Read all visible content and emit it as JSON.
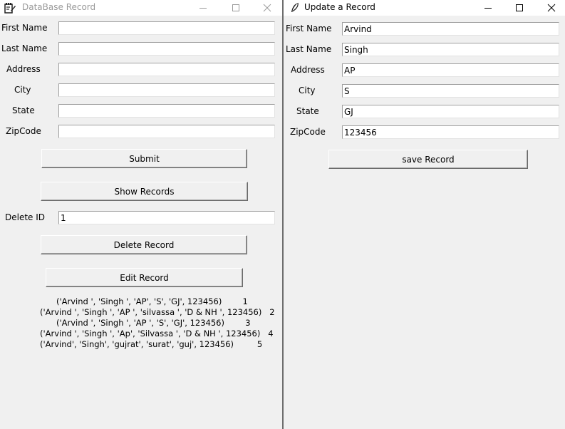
{
  "left_window": {
    "title": "DataBase Record",
    "labels": {
      "first_name": "First Name",
      "last_name": "Last Name",
      "address": "Address",
      "city": "City",
      "state": "State",
      "zipcode": "ZipCode",
      "delete_id": "Delete ID"
    },
    "values": {
      "first_name": "",
      "last_name": "",
      "address": "",
      "city": "",
      "state": "",
      "zipcode": "",
      "delete_id": "1"
    },
    "buttons": {
      "submit": "Submit",
      "show_records": "Show Records",
      "delete_record": "Delete Record",
      "edit_record": "Edit Record"
    },
    "records": [
      "('Arvind ', 'Singh ', 'AP', 'S', 'GJ', 123456)        1",
      "('Arvind ', 'Singh ', 'AP ', 'silvassa ', 'D & NH ', 123456)   2",
      "('Arvind ', 'Singh ', 'AP ', 'S', 'GJ', 123456)        3",
      "('Arvind ', 'Singh ', 'Ap', 'Silvassa ', 'D & NH ', 123456)   4",
      "('Arvind', 'Singh', 'gujrat', 'surat', 'guj', 123456)         5"
    ]
  },
  "right_window": {
    "title": "Update a Record",
    "labels": {
      "first_name": "First Name",
      "last_name": "Last Name",
      "address": "Address",
      "city": "City",
      "state": "State",
      "zipcode": "ZipCode"
    },
    "values": {
      "first_name": "Arvind",
      "last_name": "Singh",
      "address": "AP",
      "city": "S",
      "state": "GJ",
      "zipcode": "123456"
    },
    "buttons": {
      "save_record": "save Record"
    }
  },
  "icons": {
    "left_window_icon": "notepad-pen-icon",
    "right_window_icon": "feather-icon",
    "minimize": "minimize-icon",
    "maximize": "maximize-icon",
    "close": "close-icon"
  }
}
